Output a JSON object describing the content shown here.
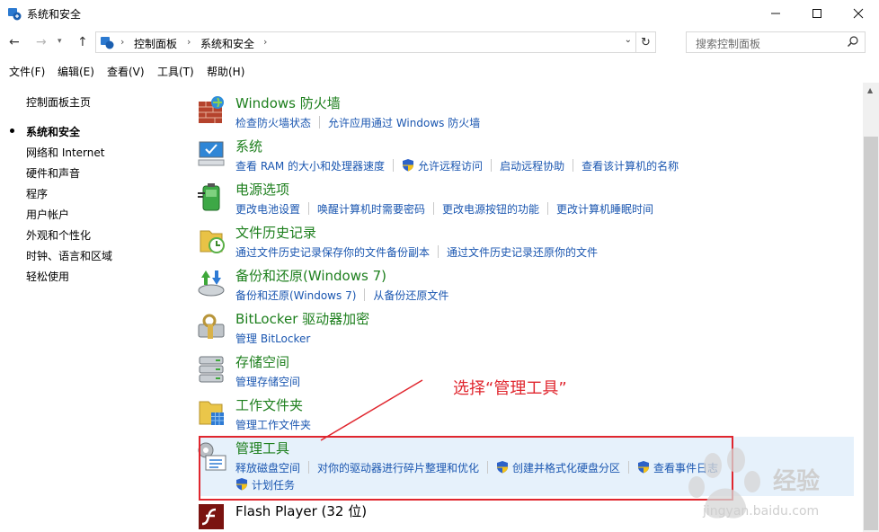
{
  "window": {
    "title": "系统和安全"
  },
  "address": {
    "crumbs": [
      "控制面板",
      "系统和安全"
    ],
    "search_placeholder": "搜索控制面板"
  },
  "menu": [
    "文件(F)",
    "编辑(E)",
    "查看(V)",
    "工具(T)",
    "帮助(H)"
  ],
  "leftnav": {
    "home": "控制面板主页",
    "items": [
      "系统和安全",
      "网络和 Internet",
      "硬件和声音",
      "程序",
      "用户帐户",
      "外观和个性化",
      "时钟、语言和区域",
      "轻松使用"
    ]
  },
  "categories": [
    {
      "title": "Windows 防火墙",
      "links": [
        "检查防火墙状态",
        "允许应用通过 Windows 防火墙"
      ]
    },
    {
      "title": "系统",
      "links": [
        "查看 RAM 的大小和处理器速度",
        "允许远程访问",
        "启动远程协助",
        "查看该计算机的名称"
      ]
    },
    {
      "title": "电源选项",
      "links": [
        "更改电池设置",
        "唤醒计算机时需要密码",
        "更改电源按钮的功能",
        "更改计算机睡眠时间"
      ]
    },
    {
      "title": "文件历史记录",
      "links": [
        "通过文件历史记录保存你的文件备份副本",
        "通过文件历史记录还原你的文件"
      ]
    },
    {
      "title": "备份和还原(Windows 7)",
      "links": [
        "备份和还原(Windows 7)",
        "从备份还原文件"
      ]
    },
    {
      "title": "BitLocker 驱动器加密",
      "links": [
        "管理 BitLocker"
      ]
    },
    {
      "title": "存储空间",
      "links": [
        "管理存储空间"
      ]
    },
    {
      "title": "工作文件夹",
      "links": [
        "管理工作文件夹"
      ]
    },
    {
      "title": "管理工具",
      "links": [
        "释放磁盘空间",
        "对你的驱动器进行碎片整理和优化",
        "创建并格式化硬盘分区",
        "查看事件日志",
        "计划任务"
      ]
    },
    {
      "title": "Flash Player (32 位)",
      "links": []
    }
  ],
  "annotation": "选择“管理工具”",
  "watermark": {
    "brand": "经验",
    "url": "jingyan.baidu.com"
  },
  "colors": {
    "title_green": "#1d7f1d",
    "link_blue": "#1a56b0",
    "annotation_red": "#e0262e",
    "highlight": "#e6f1fb"
  }
}
